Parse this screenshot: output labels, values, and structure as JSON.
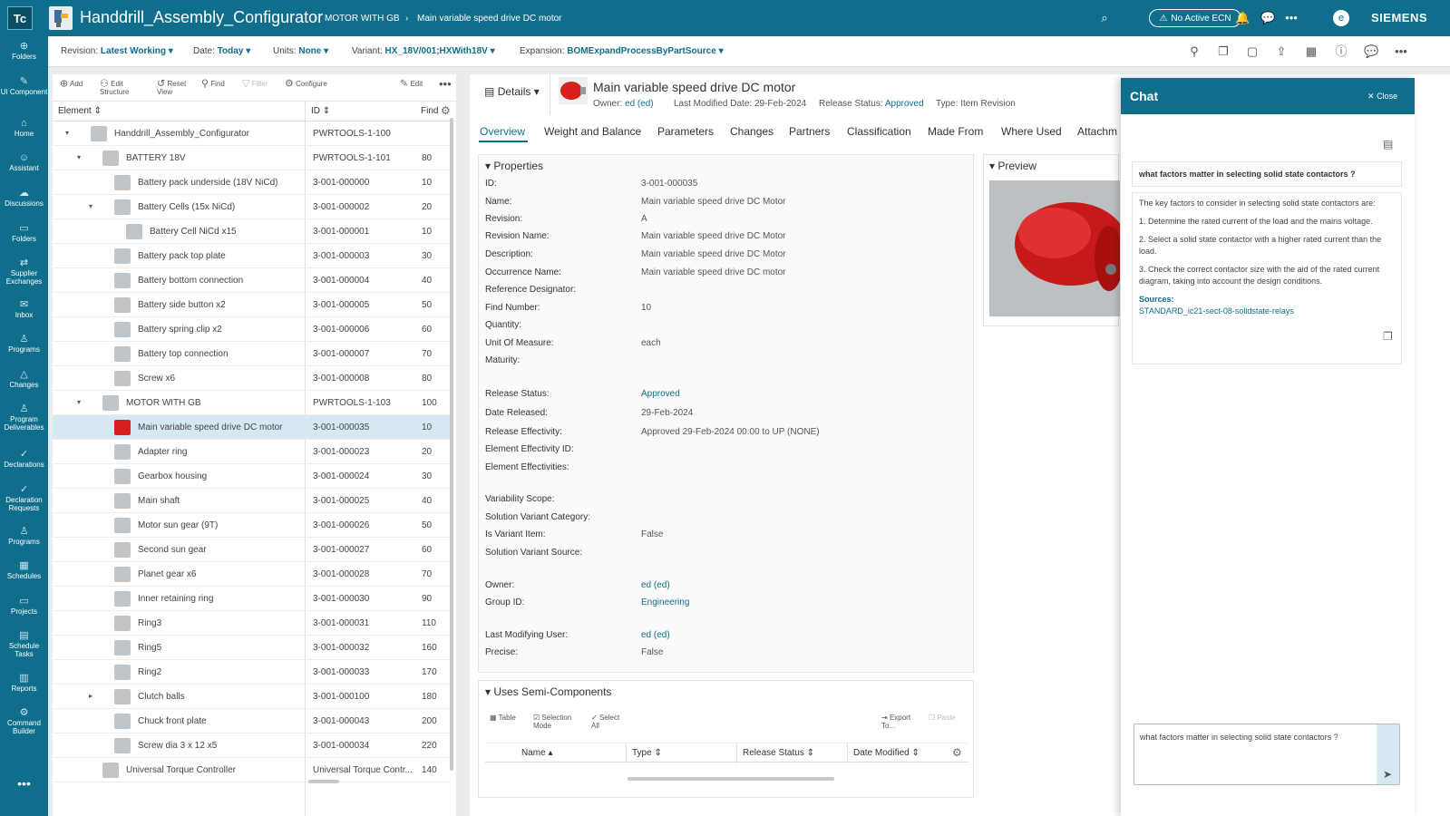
{
  "header": {
    "logo": "Tc",
    "title": "Handdrill_Assembly_Configurator",
    "crumb1": "MOTOR WITH GB",
    "crumb2": "Main variable speed drive DC motor",
    "ecn": "No Active ECN",
    "avatar": "e",
    "brand": "SIEMENS"
  },
  "sidebar": [
    "Folders",
    "UI Component",
    "Home",
    "Assistant",
    "Discussions",
    "Folders",
    "Supplier Exchanges",
    "Inbox",
    "Programs",
    "Changes",
    "Program Deliverables",
    "Declarations",
    "Declaration Requests",
    "Programs",
    "Schedules",
    "Projects",
    "Schedule Tasks",
    "Reports",
    "Command Builder"
  ],
  "revbar": {
    "revision_label": "Revision:",
    "revision": "Latest Working",
    "date_label": "Date:",
    "date": "Today",
    "units_label": "Units:",
    "units": "None",
    "variant_label": "Variant:",
    "variant": "HX_18V/001;HXWith18V",
    "expansion_label": "Expansion:",
    "expansion": "BOMExpandProcessByPartSource"
  },
  "treetools": {
    "add": "Add",
    "edit_structure": "Edit Structure",
    "reset_view": "Reset View",
    "find": "Find",
    "filter": "Filter",
    "configure": "Configure",
    "edit": "Edit"
  },
  "treecols": {
    "element": "Element",
    "id": "ID",
    "find": "Find"
  },
  "tree": [
    {
      "name": "Handdrill_Assembly_Configurator",
      "id": "PWRTOOLS-1-100",
      "find": "",
      "level": 0,
      "exp": "▾"
    },
    {
      "name": "BATTERY 18V",
      "id": "PWRTOOLS-1-101",
      "find": "80",
      "level": 1,
      "exp": "▾"
    },
    {
      "name": "Battery pack underside (18V NiCd)",
      "id": "3-001-000000",
      "find": "10",
      "level": 2,
      "exp": ""
    },
    {
      "name": "Battery Cells (15x NiCd)",
      "id": "3-001-000002",
      "find": "20",
      "level": 2,
      "exp": "▾"
    },
    {
      "name": "Battery Cell NiCd x15",
      "id": "3-001-000001",
      "find": "10",
      "level": 3,
      "exp": ""
    },
    {
      "name": "Battery pack top plate",
      "id": "3-001-000003",
      "find": "30",
      "level": 2,
      "exp": ""
    },
    {
      "name": "Battery bottom connection",
      "id": "3-001-000004",
      "find": "40",
      "level": 2,
      "exp": ""
    },
    {
      "name": "Battery side button x2",
      "id": "3-001-000005",
      "find": "50",
      "level": 2,
      "exp": ""
    },
    {
      "name": "Battery spring clip x2",
      "id": "3-001-000006",
      "find": "60",
      "level": 2,
      "exp": ""
    },
    {
      "name": "Battery top connection",
      "id": "3-001-000007",
      "find": "70",
      "level": 2,
      "exp": ""
    },
    {
      "name": "Screw x6",
      "id": "3-001-000008",
      "find": "80",
      "level": 2,
      "exp": ""
    },
    {
      "name": "MOTOR WITH GB",
      "id": "PWRTOOLS-1-103",
      "find": "100",
      "level": 1,
      "exp": "▾"
    },
    {
      "name": "Main variable speed drive DC motor",
      "id": "3-001-000035",
      "find": "10",
      "level": 2,
      "exp": "",
      "sel": true
    },
    {
      "name": "Adapter ring",
      "id": "3-001-000023",
      "find": "20",
      "level": 2,
      "exp": ""
    },
    {
      "name": "Gearbox housing",
      "id": "3-001-000024",
      "find": "30",
      "level": 2,
      "exp": ""
    },
    {
      "name": "Main shaft",
      "id": "3-001-000025",
      "find": "40",
      "level": 2,
      "exp": ""
    },
    {
      "name": "Motor sun gear (9T)",
      "id": "3-001-000026",
      "find": "50",
      "level": 2,
      "exp": ""
    },
    {
      "name": "Second sun gear",
      "id": "3-001-000027",
      "find": "60",
      "level": 2,
      "exp": ""
    },
    {
      "name": "Planet gear x6",
      "id": "3-001-000028",
      "find": "70",
      "level": 2,
      "exp": ""
    },
    {
      "name": "Inner retaining ring",
      "id": "3-001-000030",
      "find": "90",
      "level": 2,
      "exp": ""
    },
    {
      "name": "Ring3",
      "id": "3-001-000031",
      "find": "110",
      "level": 2,
      "exp": ""
    },
    {
      "name": "Ring5",
      "id": "3-001-000032",
      "find": "160",
      "level": 2,
      "exp": ""
    },
    {
      "name": "Ring2",
      "id": "3-001-000033",
      "find": "170",
      "level": 2,
      "exp": ""
    },
    {
      "name": "Clutch balls",
      "id": "3-001-000100",
      "find": "180",
      "level": 2,
      "exp": "▸"
    },
    {
      "name": "Chuck front plate",
      "id": "3-001-000043",
      "find": "200",
      "level": 2,
      "exp": ""
    },
    {
      "name": "Screw dia 3 x 12 x5",
      "id": "3-001-000034",
      "find": "220",
      "level": 2,
      "exp": ""
    },
    {
      "name": "Universal Torque Controller",
      "id": "Universal Torque Contr...",
      "find": "140",
      "level": 1,
      "exp": ""
    }
  ],
  "details": {
    "button": "Details",
    "title": "Main variable speed drive DC motor",
    "owner_label": "Owner:",
    "owner": "ed (ed)",
    "modified_label": "Last Modified Date:",
    "modified": "29-Feb-2024",
    "status_label": "Release Status:",
    "status": "Approved",
    "type_label": "Type:",
    "type": "Item Revision"
  },
  "tabs": [
    "Overview",
    "Weight and Balance",
    "Parameters",
    "Changes",
    "Partners",
    "Classification",
    "Made From",
    "Where Used",
    "Attachm"
  ],
  "properties_title": "Properties",
  "properties": [
    {
      "label": "ID:",
      "value": "3-001-000035"
    },
    {
      "label": "Name:",
      "value": "Main variable speed drive DC Motor"
    },
    {
      "label": "Revision:",
      "value": "A"
    },
    {
      "label": "Revision Name:",
      "value": "Main variable speed drive DC Motor"
    },
    {
      "label": "Description:",
      "value": "Main variable speed drive DC Motor"
    },
    {
      "label": "Occurrence Name:",
      "value": "Main variable speed drive DC motor"
    },
    {
      "label": "Reference Designator:",
      "value": ""
    },
    {
      "label": "Find Number:",
      "value": "10"
    },
    {
      "label": "Quantity:",
      "value": ""
    },
    {
      "label": "Unit Of Measure:",
      "value": "each"
    },
    {
      "label": "Maturity:",
      "value": ""
    },
    {
      "label": "Release Status:",
      "value": "Approved",
      "link": true
    },
    {
      "label": "Date Released:",
      "value": "29-Feb-2024"
    },
    {
      "label": "Release Effectivity:",
      "value": "Approved 29-Feb-2024 00:00 to UP (NONE)"
    },
    {
      "label": "Element Effectivity ID:",
      "value": ""
    },
    {
      "label": "Element Effectivities:",
      "value": ""
    },
    {
      "label": "Variability Scope:",
      "value": ""
    },
    {
      "label": "Solution Variant Category:",
      "value": ""
    },
    {
      "label": "Is Variant Item:",
      "value": "False"
    },
    {
      "label": "Solution Variant Source:",
      "value": ""
    },
    {
      "label": "Owner:",
      "value": "ed (ed)",
      "link": true
    },
    {
      "label": "Group ID:",
      "value": "Engineering",
      "link": true
    },
    {
      "label": "Last Modifying User:",
      "value": "ed (ed)",
      "link": true
    },
    {
      "label": "Precise:",
      "value": "False"
    }
  ],
  "preview_title": "Preview",
  "semi": {
    "title": "Uses Semi-Components",
    "table": "Table",
    "selection_mode": "Selection Mode",
    "select_all": "Select All",
    "export": "Export To...",
    "paste": "Paste",
    "cols": [
      "Name",
      "Type",
      "Release Status",
      "Date Modified"
    ]
  },
  "chat": {
    "title": "Chat",
    "close": "Close",
    "question": "what factors matter in selecting solid state contactors ?",
    "intro": "The key factors to consider in selecting solid state contactors are:",
    "points": [
      "1. Determine the rated current of the load and the mains voltage.",
      "2. Select a solid state contactor with a higher rated current than the load.",
      "3. Check the correct contactor size with the aid of the rated current diagram, taking into account the design conditions."
    ],
    "sources_label": "Sources:",
    "source": "STANDARD_ic21-sect-08-solidstate-relays",
    "input_value": "what factors matter in selecting solid state contactors ?"
  },
  "colors": {
    "primary": "#0f6e8c",
    "selected": "#d6e9f3",
    "motor_red": "#d81e1e"
  }
}
